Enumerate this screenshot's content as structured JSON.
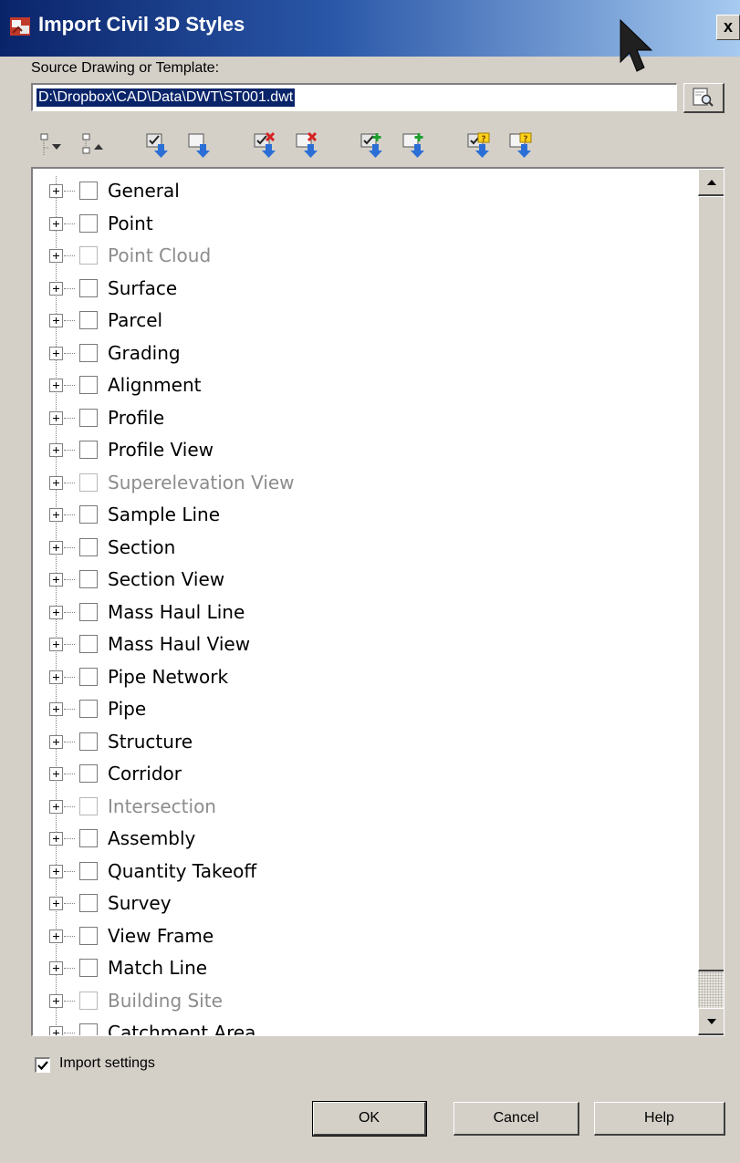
{
  "window": {
    "title": "Import Civil 3D Styles",
    "close_label": "x"
  },
  "source": {
    "label": "Source Drawing or Template:",
    "path": "D:\\Dropbox\\CAD\\Data\\DWT\\ST001.dwt"
  },
  "toolbar": [
    {
      "icon": "expand-all-icon"
    },
    {
      "icon": "collapse-all-icon"
    },
    {
      "icon": "check-all-icon"
    },
    {
      "icon": "uncheck-all-icon"
    },
    {
      "icon": "delete-check-icon"
    },
    {
      "icon": "delete-icon"
    },
    {
      "icon": "add-check-icon"
    },
    {
      "icon": "add-icon"
    },
    {
      "icon": "conflict-check-icon"
    },
    {
      "icon": "conflict-icon"
    }
  ],
  "tree": {
    "items": [
      {
        "label": "General",
        "enabled": true
      },
      {
        "label": "Point",
        "enabled": true
      },
      {
        "label": "Point Cloud",
        "enabled": false
      },
      {
        "label": "Surface",
        "enabled": true
      },
      {
        "label": "Parcel",
        "enabled": true
      },
      {
        "label": "Grading",
        "enabled": true
      },
      {
        "label": "Alignment",
        "enabled": true
      },
      {
        "label": "Profile",
        "enabled": true
      },
      {
        "label": "Profile View",
        "enabled": true
      },
      {
        "label": "Superelevation View",
        "enabled": false
      },
      {
        "label": "Sample Line",
        "enabled": true
      },
      {
        "label": "Section",
        "enabled": true
      },
      {
        "label": "Section View",
        "enabled": true
      },
      {
        "label": "Mass Haul Line",
        "enabled": true
      },
      {
        "label": "Mass Haul View",
        "enabled": true
      },
      {
        "label": "Pipe Network",
        "enabled": true
      },
      {
        "label": "Pipe",
        "enabled": true
      },
      {
        "label": "Structure",
        "enabled": true
      },
      {
        "label": "Corridor",
        "enabled": true
      },
      {
        "label": "Intersection",
        "enabled": false
      },
      {
        "label": "Assembly",
        "enabled": true
      },
      {
        "label": "Quantity Takeoff",
        "enabled": true
      },
      {
        "label": "Survey",
        "enabled": true
      },
      {
        "label": "View Frame",
        "enabled": true
      },
      {
        "label": "Match Line",
        "enabled": true
      },
      {
        "label": "Building Site",
        "enabled": false
      },
      {
        "label": "Catchment Area",
        "enabled": true
      }
    ]
  },
  "import_settings": {
    "label": "Import settings",
    "checked": true
  },
  "buttons": {
    "ok": "OK",
    "cancel": "Cancel",
    "help": "Help"
  },
  "colors": {
    "title_start": "#0a246a",
    "title_end": "#a6caf0",
    "dialog_bg": "#d4d0c8",
    "selection": "#0a246a",
    "disabled_text": "#8c8c8c"
  }
}
